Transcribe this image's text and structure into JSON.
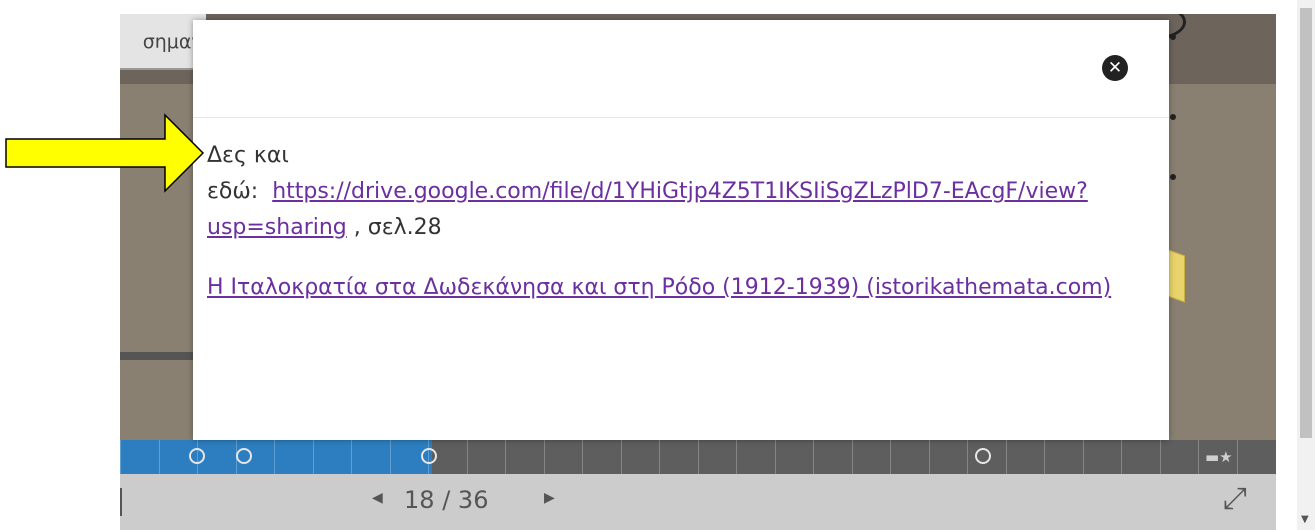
{
  "slide": {
    "title_tab": "σημαν"
  },
  "modal": {
    "intro_line": "Δες και",
    "here_label": "εδώ:",
    "drive_link_text": "https://drive.google.com/file/d/1YHiGtjp4Z5T1IKSIiSgZLzPlD7-EAcgF/view?usp=sharing",
    "page_ref": ", σελ.28",
    "article_link_text": "Η Ιταλοκρατία στα Δωδεκάνησα και στη Ρόδο (1912-1939) (istorikathemata.com)",
    "close_icon": "close-icon"
  },
  "timeline": {
    "progress": 0.27,
    "markers": [
      0.06,
      0.1,
      0.26,
      0.74
    ],
    "tool_icon": "pen-star-icon"
  },
  "nav": {
    "current_page": "18",
    "separator": "/",
    "total_pages": "36",
    "prev_icon": "triangle-left-icon",
    "next_icon": "triangle-right-icon",
    "fullscreen_icon": "expand-icon"
  },
  "colors": {
    "link": "#6b2fa0",
    "timeline_progress": "#2d7ec0",
    "arrow": "#ffff00"
  }
}
